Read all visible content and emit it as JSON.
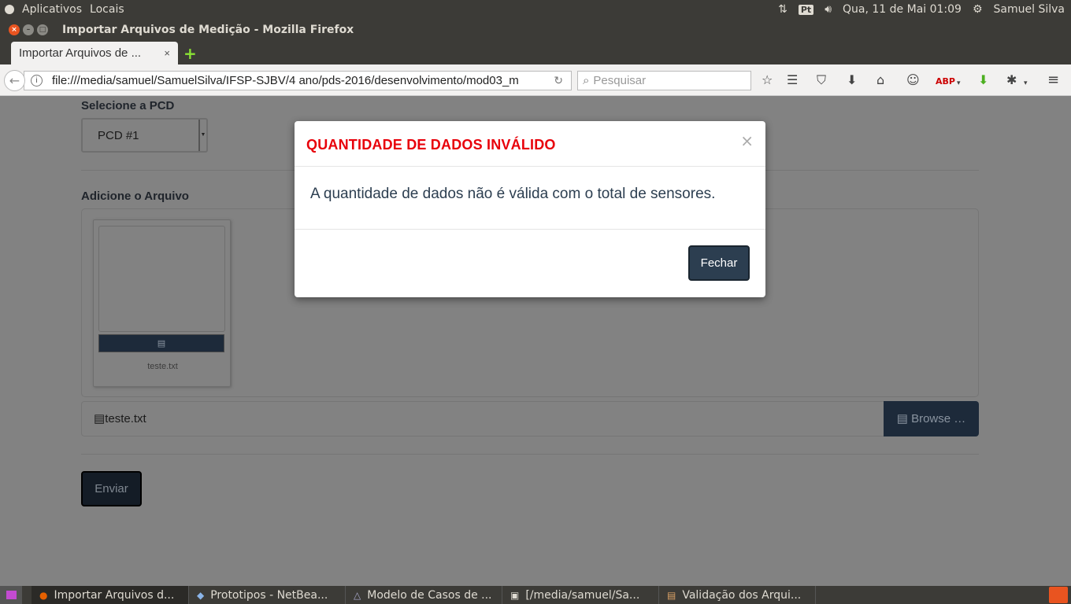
{
  "panel": {
    "apps": "Aplicativos",
    "places": "Locais",
    "lang": "Pt",
    "datetime": "Qua, 11 de Mai 01:09",
    "user": "Samuel Silva"
  },
  "window": {
    "title": "Importar Arquivos de Medição - Mozilla Firefox"
  },
  "tab": {
    "label": "Importar Arquivos de ...",
    "close": "×",
    "new": "+"
  },
  "nav": {
    "url": "file:///media/samuel/SamuelSilva/IFSP-SJBV/4 ano/pds-2016/desenvolvimento/mod03_m",
    "search_placeholder": "Pesquisar"
  },
  "form": {
    "pcd_label": "Selecione a PCD",
    "pcd_value": "PCD #1",
    "file_label": "Adicione o Arquivo",
    "thumb_name": "teste.txt",
    "file_value": "teste.txt",
    "browse": "Browse …",
    "submit": "Enviar"
  },
  "modal": {
    "title": "QUANTIDADE DE DADOS INVÁLIDO",
    "close": "×",
    "message": "A quantidade de dados não é válida com o total de sensores.",
    "button": "Fechar"
  },
  "taskbar": {
    "items": [
      "Importar Arquivos d...",
      "Prototipos - NetBea...",
      "Modelo de Casos de ...",
      "[/media/samuel/Sa...",
      "Validação dos Arqui..."
    ]
  }
}
